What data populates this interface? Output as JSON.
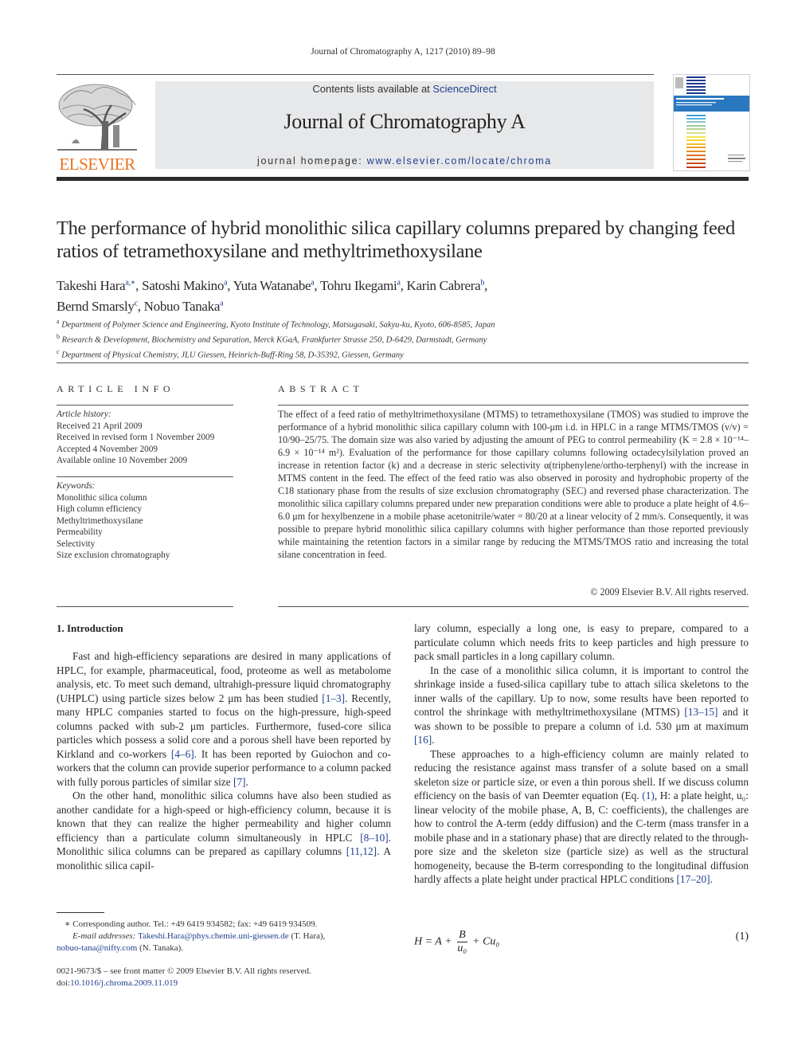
{
  "header": {
    "running_head": "Journal of Chromatography A, 1217 (2010) 89–98",
    "publisher": "ELSEVIER",
    "contents_prefix": "Contents lists available at ",
    "contents_link": "ScienceDirect",
    "journal_name": "Journal of Chromatography A",
    "homepage_prefix": "journal homepage: ",
    "homepage_link": "www.elsevier.com/locate/chroma",
    "brand_color": "#e8731f",
    "link_color": "#1f3f8f"
  },
  "article": {
    "title": "The performance of hybrid monolithic silica capillary columns prepared by changing feed ratios of tetramethoxysilane and methyltrimethoxysilane",
    "authors": [
      {
        "name": "Takeshi Hara",
        "aff": "a,∗",
        "sep": ", "
      },
      {
        "name": "Satoshi Makino",
        "aff": "a",
        "sep": ", "
      },
      {
        "name": "Yuta Watanabe",
        "aff": "a",
        "sep": ", "
      },
      {
        "name": "Tohru Ikegami",
        "aff": "a",
        "sep": ", "
      },
      {
        "name": "Karin Cabrera",
        "aff": "b",
        "sep": ","
      },
      {
        "name": "Bernd Smarsly",
        "aff": "c",
        "sep": ", "
      },
      {
        "name": "Nobuo Tanaka",
        "aff": "a",
        "sep": ""
      }
    ],
    "affiliations": [
      {
        "key": "a",
        "text": "Department of Polymer Science and Engineering, Kyoto Institute of Technology, Matsugasaki, Sakyu-ku, Kyoto, 606-8585, Japan"
      },
      {
        "key": "b",
        "text": "Research & Development, Biochemistry and Separation, Merck KGaA, Frankfurter Strasse 250, D-6429, Darmstadt, Germany"
      },
      {
        "key": "c",
        "text": "Department of Physical Chemistry, JLU Giessen, Heinrich-Buff-Ring 58, D-35392, Giessen, Germany"
      }
    ]
  },
  "article_info": {
    "heading": "ARTICLE INFO",
    "history_label": "Article history:",
    "history": [
      "Received 21 April 2009",
      "Received in revised form 1 November 2009",
      "Accepted 4 November 2009",
      "Available online 10 November 2009"
    ],
    "keywords_label": "Keywords:",
    "keywords": [
      "Monolithic silica column",
      "High column efficiency",
      "Methyltrimethoxysilane",
      "Permeability",
      "Selectivity",
      "Size exclusion chromatography"
    ]
  },
  "abstract": {
    "heading": "ABSTRACT",
    "text": "The effect of a feed ratio of methyltrimethoxysilane (MTMS) to tetramethoxysilane (TMOS) was studied to improve the performance of a hybrid monolithic silica capillary column with 100-μm i.d. in HPLC in a range MTMS/TMOS (v/v) = 10/90–25/75. The domain size was also varied by adjusting the amount of PEG to control permeability (K = 2.8 × 10⁻¹⁴–6.9 × 10⁻¹⁴ m²). Evaluation of the performance for those capillary columns following octadecylsilylation proved an increase in retention factor (k) and a decrease in steric selectivity α(triphenylene/ortho-terphenyl) with the increase in MTMS content in the feed. The effect of the feed ratio was also observed in porosity and hydrophobic property of the C18 stationary phase from the results of size exclusion chromatography (SEC) and reversed phase characterization. The monolithic silica capillary columns prepared under new preparation conditions were able to produce a plate height of 4.6–6.0 μm for hexylbenzene in a mobile phase acetonitrile/water = 80/20 at a linear velocity of 2 mm/s. Consequently, it was possible to prepare hybrid monolithic silica capillary columns with higher performance than those reported previously while maintaining the retention factors in a similar range by reducing the MTMS/TMOS ratio and increasing the total silane concentration in feed.",
    "copyright": "© 2009 Elsevier B.V. All rights reserved."
  },
  "body": {
    "section_heading": "1.  Introduction",
    "left_paragraphs": [
      {
        "parts": [
          {
            "t": "Fast and high-efficiency separations are desired in many applications of HPLC, for example, pharmaceutical, food, proteome as well as metabolome analysis, etc. To meet such demand, ultrahigh-pressure liquid chromatography (UHPLC) using particle sizes below 2 μm has been studied "
          },
          {
            "t": "[1–3]",
            "ref": true
          },
          {
            "t": ". Recently, many HPLC companies started to focus on the high-pressure, high-speed columns packed with sub-2 μm particles. Furthermore, fused-core silica particles which possess a solid core and a porous shell have been reported by Kirkland and co-workers "
          },
          {
            "t": "[4–6]",
            "ref": true
          },
          {
            "t": ". It has been reported by Guiochon and co-workers that the column can provide superior performance to a column packed with fully porous particles of similar size "
          },
          {
            "t": "[7]",
            "ref": true
          },
          {
            "t": "."
          }
        ]
      },
      {
        "parts": [
          {
            "t": "On the other hand, monolithic silica columns have also been studied as another candidate for a high-speed or high-efficiency column, because it is known that they can realize the higher permeability and higher column efficiency than a particulate column simultaneously in HPLC "
          },
          {
            "t": "[8–10]",
            "ref": true
          },
          {
            "t": ". Monolithic silica columns can be prepared as capillary columns "
          },
          {
            "t": "[11,12]",
            "ref": true
          },
          {
            "t": ". A monolithic silica capil-"
          }
        ]
      }
    ],
    "right_paragraphs": [
      {
        "cont": true,
        "parts": [
          {
            "t": "lary column, especially a long one, is easy to prepare, compared to a particulate column which needs frits to keep particles and high pressure to pack small particles in a long capillary column."
          }
        ]
      },
      {
        "parts": [
          {
            "t": "In the case of a monolithic silica column, it is important to control the shrinkage inside a fused-silica capillary tube to attach silica skeletons to the inner walls of the capillary. Up to now, some results have been reported to control the shrinkage with methyltrimethoxysilane (MTMS) "
          },
          {
            "t": "[13–15]",
            "ref": true
          },
          {
            "t": " and it was shown to be possible to prepare a column of i.d. 530 μm at maximum "
          },
          {
            "t": "[16]",
            "ref": true
          },
          {
            "t": "."
          }
        ]
      },
      {
        "parts": [
          {
            "t": "These approaches to a high-efficiency column are mainly related to reducing the resistance against mass transfer of a solute based on a small skeleton size or particle size, or even a thin porous shell. If we discuss column efficiency on the basis of van Deemter equation (Eq. "
          },
          {
            "t": "(1)",
            "ref": true
          },
          {
            "t": ", H: a plate height, u₀: linear velocity of the mobile phase, A, B, C: coefficients), the challenges are how to control the A-term (eddy diffusion) and the C-term (mass transfer in a mobile phase and in a stationary phase) that are directly related to the through-pore size and the skeleton size (particle size) as well as the structural homogeneity, because the B-term corresponding to the longitudinal diffusion hardly affects a plate height under practical HPLC conditions "
          },
          {
            "t": "[17–20]",
            "ref": true
          },
          {
            "t": "."
          }
        ]
      }
    ],
    "equation": {
      "lhs": "H = A + ",
      "numerator": "B",
      "denominator": "u₀",
      "rhs": " + Cu₀",
      "number": "(1)"
    }
  },
  "footnotes": {
    "corresponding": "∗  Corresponding author. Tel.: +49 6419 934582; fax: +49 6419 934509.",
    "email_label": "E-mail addresses: ",
    "email1": "Takeshi.Hara@phys.chemie.uni-giessen.de",
    "email1_owner": " (T. Hara),",
    "email2": "nobuo-tana@nifty.com",
    "email2_owner": " (N. Tanaka).",
    "front_matter": "0021-9673/$ – see front matter © 2009 Elsevier B.V. All rights reserved.",
    "doi_prefix": "doi:",
    "doi": "10.1016/j.chroma.2009.11.019"
  }
}
